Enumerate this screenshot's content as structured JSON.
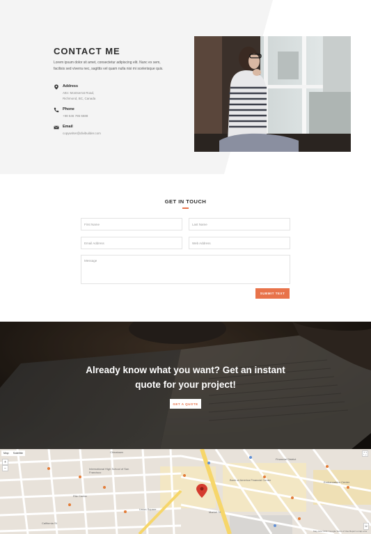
{
  "contact": {
    "title": "CONTACT ME",
    "intro": "Lorem ipsum dolor sit amet, consectetur adipiscing elit. Nunc ex sem, facilisis sed viverra nec, sagittis vel quam nulla nisi mi scelerisque quis.",
    "address": {
      "label": "Address",
      "line1": "Attn: Montserrat Road,",
      "line2": "Richmond, BC, Canada"
    },
    "phone": {
      "label": "Phone",
      "value": "+98 646 785 6688"
    },
    "email": {
      "label": "Email",
      "value": "copywriter@divibuilder.com"
    }
  },
  "form": {
    "title": "GET IN TOUCH",
    "first_name_placeholder": "First Name",
    "last_name_placeholder": "Last Name",
    "email_placeholder": "Email Address",
    "web_placeholder": "Web Address",
    "message_placeholder": "Message",
    "submit_label": "SUBMIT TEXT"
  },
  "quote": {
    "heading_line1": "Already know what you want? Get an instant",
    "heading_line2": "quote for your project!",
    "button_label": "GET A QUOTE"
  },
  "map": {
    "type_options": [
      "Map",
      "Satellite"
    ],
    "zoom_in": "+",
    "zoom_out": "−",
    "labels": {
      "l1": "Chinatown",
      "l2": "International High School of San Francisco",
      "l3": "Bank of America Financial Center",
      "l4": "Ritz Center",
      "l5": "Financial District",
      "l6": "Embarcadero Center",
      "l7": "California St",
      "l8": "Market St",
      "l9": "Union Square"
    },
    "attribution": "Map data ©2017 Google  Terms of Use  Report a map error"
  },
  "colors": {
    "accent": "#e8734a",
    "contact_bg": "#f4f4f4",
    "quote_overlay": "#1e1a16"
  }
}
